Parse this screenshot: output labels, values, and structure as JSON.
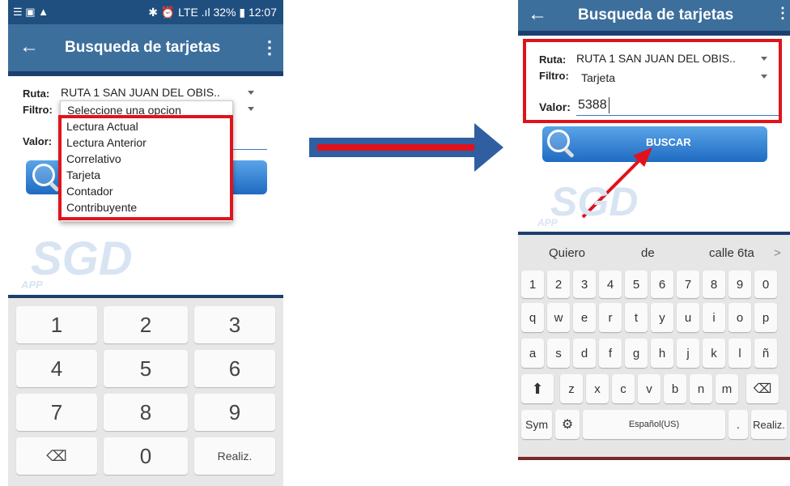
{
  "left": {
    "status": {
      "left_icons": "☰ ▣ ▲",
      "right_text": "✱ ⏰ LTE .ıl 32% ▮ 12:07"
    },
    "appbar": {
      "back": "←",
      "title": "Busqueda de tarjetas",
      "menu": "⋮"
    },
    "form": {
      "ruta_label": "Ruta:",
      "ruta_value": "RUTA 1 SAN JUAN DEL OBIS..",
      "filtro_label": "Filtro:",
      "filtro_value": "Seleccione una opcion",
      "valor_label": "Valor:"
    },
    "dropdown_options": [
      "Lectura Actual",
      "Lectura Anterior",
      "Correlativo",
      "Tarjeta",
      "Contador",
      "Contribuyente"
    ],
    "logo": {
      "main": "SGD",
      "sub": "APP"
    },
    "numpad": {
      "keys": [
        "1",
        "2",
        "3",
        "4",
        "5",
        "6",
        "7",
        "8",
        "9",
        "⌫",
        "0",
        "Realiz."
      ]
    }
  },
  "right": {
    "appbar": {
      "back": "←",
      "title": "Busqueda de tarjetas",
      "menu": "⋮"
    },
    "form": {
      "ruta_label": "Ruta:",
      "ruta_value": "RUTA 1 SAN JUAN DEL OBIS..",
      "filtro_label": "Filtro:",
      "filtro_value": "Tarjeta",
      "valor_label": "Valor:",
      "valor_value": "5388"
    },
    "search_button": "BUSCAR",
    "logo": {
      "main": "SGD",
      "sub": "APP"
    },
    "keyboard": {
      "suggestions": [
        "Quiero",
        "de",
        "calle 6ta"
      ],
      "more": ">",
      "row_numbers": [
        "1",
        "2",
        "3",
        "4",
        "5",
        "6",
        "7",
        "8",
        "9",
        "0"
      ],
      "row1": [
        "q",
        "w",
        "e",
        "r",
        "t",
        "y",
        "u",
        "i",
        "o",
        "p"
      ],
      "row2": [
        "a",
        "s",
        "d",
        "f",
        "g",
        "h",
        "j",
        "k",
        "l",
        "ñ"
      ],
      "row3": [
        "z",
        "x",
        "c",
        "v",
        "b",
        "n",
        "m"
      ],
      "shift": "⬆",
      "backspace": "⌫",
      "sym": "Sym",
      "settings": "⚙",
      "space": "Español(US)",
      "period": ".",
      "done": "Realiz."
    }
  },
  "colors": {
    "appbar": "#3d6f9d",
    "statusbar": "#1f4f7f",
    "highlight": "#e0131c",
    "arrow": "#2f5fa0",
    "button": "#1f6bc2"
  }
}
